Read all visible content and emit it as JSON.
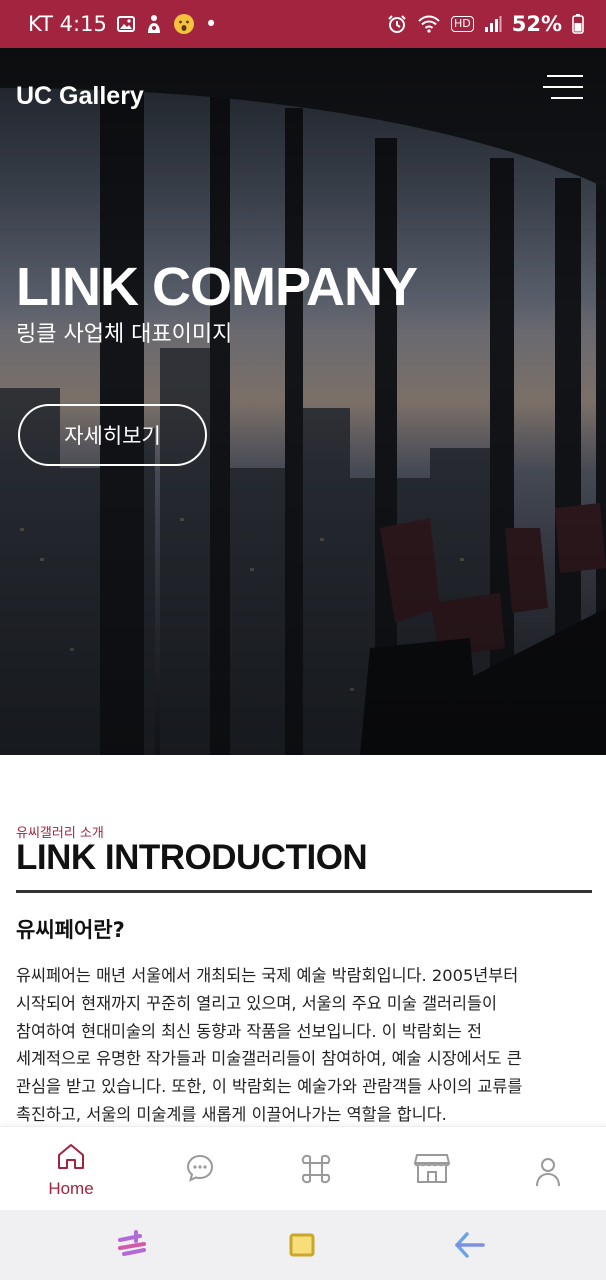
{
  "status_bar": {
    "carrier_time": "KT 4:15",
    "battery": "52%",
    "hd_badge": "HD",
    "dot": "•"
  },
  "header": {
    "brand": "UC Gallery",
    "menu_icon": "hamburger-menu-icon"
  },
  "hero": {
    "title": "LINK COMPANY",
    "subtitle": "링클 사업체 대표이미지",
    "button_label": "자세히보기"
  },
  "intro": {
    "kicker": "유씨갤러리 소개",
    "title": "LINK INTRODUCTION",
    "heading": "유씨페어란?",
    "lines": [
      "유씨페어는 매년 서울에서 개최되는 국제 예술 박람회입니다. 2005년부터",
      "시작되어 현재까지 꾸준히 열리고 있으며, 서울의 주요 미술 갤러리들이",
      "참여하여 현대미술의 최신 동향과 작품을 선보입니다. 이 박람회는 전",
      "세계적으로 유명한 작가들과 미술갤러리들이 참여하여, 예술 시장에서도 큰",
      "관심을 받고 있습니다. 또한, 이 박람회는 예술가와 관람객들 사이의 교류를",
      "촉진하고, 서울의 미술계를 새롭게 이끌어나가는 역할을 합니다."
    ]
  },
  "bottom_nav": {
    "items": [
      {
        "label": "Home",
        "icon": "home-icon",
        "active": true
      },
      {
        "label": "",
        "icon": "chat-bubble-icon",
        "active": false
      },
      {
        "label": "",
        "icon": "command-icon",
        "active": false
      },
      {
        "label": "",
        "icon": "store-icon",
        "active": false
      },
      {
        "label": "",
        "icon": "user-icon",
        "active": false
      }
    ]
  },
  "system_nav": {
    "recents_icon": "recents-icon",
    "home_icon": "square-home-icon",
    "back_icon": "back-arrow-icon"
  },
  "colors": {
    "accent": "#a3243f",
    "nav_inactive": "#9a9a9a"
  }
}
